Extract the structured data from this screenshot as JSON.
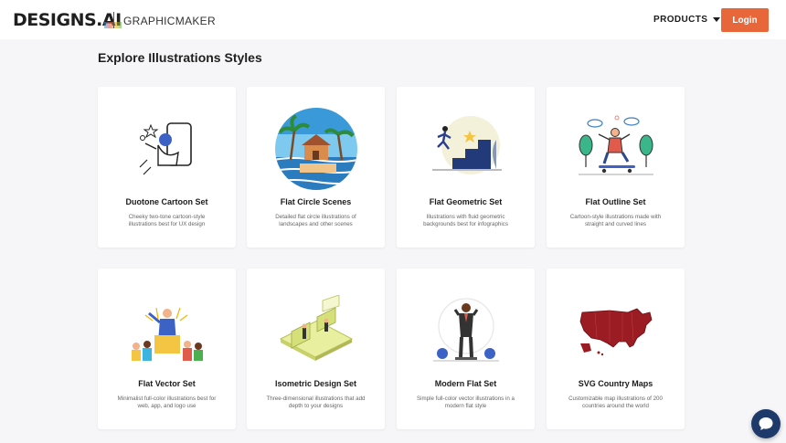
{
  "header": {
    "logo_text": "DESIGNS.",
    "logo_ai": "AI",
    "brand_secondary": "GRAPHICMAKER",
    "products_label": "PRODUCTS",
    "login_label": "Login",
    "accent_color": "#e8673a"
  },
  "main": {
    "heading": "Explore Illustrations Styles"
  },
  "cards": [
    {
      "title": "Duotone Cartoon Set",
      "desc": "Cheeky two-tone cartoon-style illustrations best for UX design",
      "icon": "duotone-phone-character-icon"
    },
    {
      "title": "Flat Circle Scenes",
      "desc": "Detailed flat circle illustrations of landscapes and other scenes",
      "icon": "beach-house-circle-icon"
    },
    {
      "title": "Flat Geometric Set",
      "desc": "Illustrations with fluid geometric backgrounds best for infographics",
      "icon": "stairs-runner-icon"
    },
    {
      "title": "Flat Outline Set",
      "desc": "Cartoon-style illustrations made with straight and curved lines",
      "icon": "skateboarder-icon"
    },
    {
      "title": "Flat Vector Set",
      "desc": "Minimalist full-color illustrations best for web, app, and logo use",
      "icon": "crowd-speaker-icon"
    },
    {
      "title": "Isometric Design Set",
      "desc": "Three-dimensional illustrations that add depth to your designs",
      "icon": "isometric-office-icon"
    },
    {
      "title": "Modern Flat Set",
      "desc": "Simple full-color vector illustrations in a modern flat style",
      "icon": "businessman-icon"
    },
    {
      "title": "SVG Country Maps",
      "desc": "Customizable map illustrations of 200 countries around the world",
      "icon": "usa-map-icon"
    }
  ],
  "chat": {
    "icon": "chat-bubble-icon"
  }
}
